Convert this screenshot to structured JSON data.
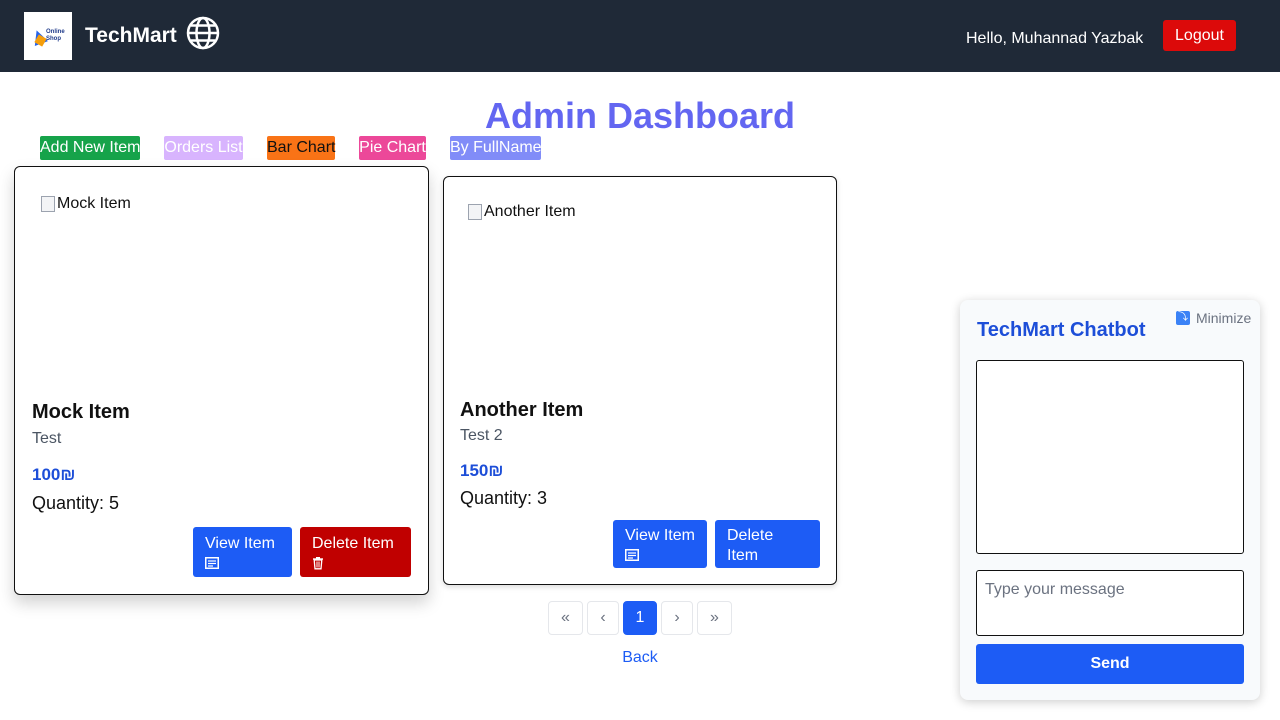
{
  "navbar": {
    "logo_text": "Online Shop",
    "brand": "TechMart",
    "greeting": "Hello, Muhannad Yazbak",
    "logout_label": "Logout"
  },
  "main": {
    "title": "Admin Dashboard",
    "actions": {
      "add_new_item": "Add New Item",
      "orders_list": "Orders List",
      "bar_chart": "Bar Chart",
      "pie_chart": "Pie Chart",
      "by_fullname": "By FullName"
    },
    "items": [
      {
        "image_alt": "Mock Item",
        "name": "Mock Item",
        "description": "Test",
        "price": "100₪",
        "quantity": "Quantity: 5",
        "view_label": "View Item",
        "delete_label": "Delete Item"
      },
      {
        "image_alt": "Another Item",
        "name": "Another Item",
        "description": "Test 2",
        "price": "150₪",
        "quantity": "Quantity: 3",
        "view_label": "View Item",
        "delete_label": "Delete Item"
      }
    ],
    "pagination": {
      "first": "«",
      "prev": "‹",
      "current": "1",
      "next": "›",
      "last": "»"
    },
    "back_label": "Back"
  },
  "chatbot": {
    "minimize_label": "Minimize",
    "title": "TechMart Chatbot",
    "input_placeholder": "Type your message",
    "send_label": "Send"
  },
  "colors": {
    "navbar_bg": "#1f2937",
    "title": "#6366f1",
    "primary": "#1d5cf5",
    "danger": "#c00000"
  }
}
